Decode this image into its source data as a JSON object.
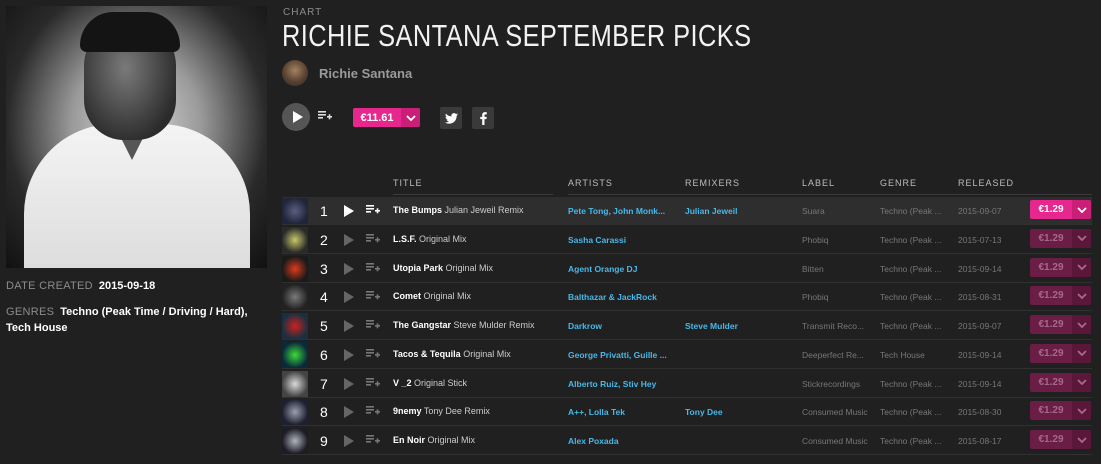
{
  "chart": {
    "kind_label": "CHART",
    "title": "RICHIE SANTANA SEPTEMBER PICKS",
    "artist": "Richie Santana",
    "price": "€11.61",
    "date_created_label": "DATE CREATED",
    "date_created": "2015-09-18",
    "genres_label": "GENRES",
    "genres": "Techno (Peak Time / Driving / Hard), Tech House"
  },
  "colors": {
    "accent": "#e6278d",
    "link": "#48b8e8",
    "background": "#202020"
  },
  "icons": [
    "play-icon",
    "add-to-queue-icon",
    "chevron-down-icon",
    "twitter-icon",
    "facebook-icon"
  ],
  "table": {
    "headers": [
      "TITLE",
      "ARTISTS",
      "REMIXERS",
      "LABEL",
      "GENRE",
      "RELEASED"
    ],
    "rows": [
      {
        "num": "1",
        "title": "The Bumps",
        "mix": "Julian Jeweil Remix",
        "artists": "Pete Tong, John Monk...",
        "remixers": "Julian Jeweil",
        "label": "Suara",
        "genre": "Techno (Peak ...",
        "released": "2015-09-07",
        "price": "€1.29"
      },
      {
        "num": "2",
        "title": "L.S.F.",
        "mix": "Original Mix",
        "artists": "Sasha Carassi",
        "remixers": "",
        "label": "Phobiq",
        "genre": "Techno (Peak ...",
        "released": "2015-07-13",
        "price": "€1.29"
      },
      {
        "num": "3",
        "title": "Utopia Park",
        "mix": "Original Mix",
        "artists": "Agent Orange DJ",
        "remixers": "",
        "label": "Bitten",
        "genre": "Techno (Peak ...",
        "released": "2015-09-14",
        "price": "€1.29"
      },
      {
        "num": "4",
        "title": "Comet",
        "mix": "Original Mix",
        "artists": "Balthazar & JackRock",
        "remixers": "",
        "label": "Phobiq",
        "genre": "Techno (Peak ...",
        "released": "2015-08-31",
        "price": "€1.29"
      },
      {
        "num": "5",
        "title": "The Gangstar",
        "mix": "Steve Mulder Remix",
        "artists": "Darkrow",
        "remixers": "Steve Mulder",
        "label": "Transmit Reco...",
        "genre": "Techno (Peak ...",
        "released": "2015-09-07",
        "price": "€1.29"
      },
      {
        "num": "6",
        "title": "Tacos & Tequila",
        "mix": "Original Mix",
        "artists": "George Privatti, Guille ...",
        "remixers": "",
        "label": "Deeperfect Re...",
        "genre": "Tech House",
        "released": "2015-09-14",
        "price": "€1.29"
      },
      {
        "num": "7",
        "title": "V _2",
        "mix": "Original Stick",
        "artists": "Alberto Ruiz, Stiv Hey",
        "remixers": "",
        "label": "Stickrecordings",
        "genre": "Techno (Peak ...",
        "released": "2015-09-14",
        "price": "€1.29"
      },
      {
        "num": "8",
        "title": "9nemy",
        "mix": "Tony Dee Remix",
        "artists": "A++, Lolla Tek",
        "remixers": "Tony Dee",
        "label": "Consumed Music",
        "genre": "Techno (Peak ...",
        "released": "2015-08-30",
        "price": "€1.29"
      },
      {
        "num": "9",
        "title": "En Noir",
        "mix": "Original Mix",
        "artists": "Alex Poxada",
        "remixers": "",
        "label": "Consumed Music",
        "genre": "Techno (Peak ...",
        "released": "2015-08-17",
        "price": "€1.29"
      }
    ]
  }
}
